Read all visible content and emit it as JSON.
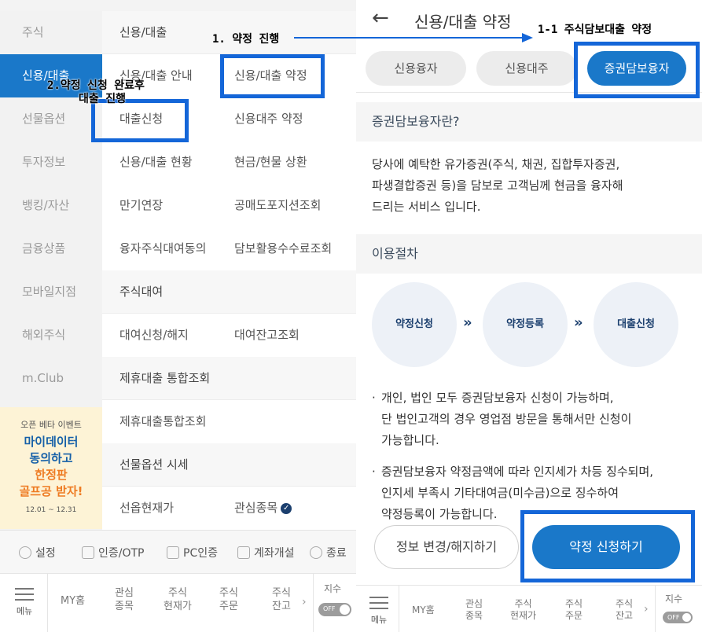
{
  "left": {
    "sidebar": [
      "주식",
      "신용/대출",
      "선물옵션",
      "투자정보",
      "뱅킹/자산",
      "금융상품",
      "모바일지점",
      "해외주식",
      "m.Club"
    ],
    "promo": {
      "top": "오픈 베타 이벤트",
      "line1": "마이데이터",
      "line2": "동의하고",
      "line3": "한정판",
      "line4": "골프공 받자!",
      "date": "12.01 ~ 12.31"
    },
    "menu": {
      "sec1": "신용/대출",
      "r1a": "신용/대출 안내",
      "r1b": "신용/대출 약정",
      "r2a": "대출신청",
      "r2b": "신용대주 약정",
      "r3a": "신용/대출 현황",
      "r3b": "현금/현물 상환",
      "r4a": "만기연장",
      "r4b": "공매도포지션조회",
      "r5a": "융자주식대여동의",
      "r5b": "담보활용수수료조회",
      "sec2": "주식대여",
      "r6a": "대여신청/해지",
      "r6b": "대여잔고조회",
      "sec3": "제휴대출 통합조회",
      "r7a": "제휴대출통합조회",
      "sec4": "선물옵션 시세",
      "r8a": "선옵현재가",
      "r8b": "관심종목"
    },
    "util": {
      "settings": "설정",
      "auth": "인증/OTP",
      "pc": "PC인증",
      "account": "계좌개설",
      "exit": "종료"
    }
  },
  "nav": {
    "menu": "메뉴",
    "home": "MY홈",
    "watch1": "관심",
    "watch2": "종목",
    "cur1": "주식",
    "cur2": "현재가",
    "order1": "주식",
    "order2": "주문",
    "bal1": "주식",
    "bal2": "잔고",
    "chev": "›",
    "index": "지수",
    "toggle": "OFF"
  },
  "right": {
    "back": "←",
    "title": "신용/대출 약정",
    "tabs": [
      "신용융자",
      "신용대주",
      "증권담보융자"
    ],
    "sec1": "증권담보융자란?",
    "desc": [
      "당사에 예탁한 유가증권(주식, 채권, 집합투자증권,",
      "파생결합증권 등)을 담보로 고객님께 현금을 융자해",
      "드리는 서비스 입니다."
    ],
    "sec2": "이용절차",
    "steps": [
      "약정신청",
      "약정등록",
      "대출신청"
    ],
    "chev": "»",
    "b1": [
      "개인, 법인 모두 증권담보융자 신청이 가능하며,",
      "단 법인고객의 경우 영업점 방문을 통해서만 신청이",
      "가능합니다."
    ],
    "b2": [
      "증권담보융자 약정금액에 따라 인지세가 차등 징수되며,",
      "인지세 부족시 기타대여금(미수금)으로 징수하여",
      "약정등록이 가능합니다."
    ],
    "bullet": "·",
    "btn_change": "정보 변경/해지하기",
    "btn_apply": "약정 신청하기"
  },
  "annotations": {
    "a1": "1. 약정 진행",
    "a11": "1-1 주식담보대출 약정",
    "a2a": "2.약정 신청 완료후",
    "a2b": "대출 진행"
  },
  "colors": {
    "accent": "#1a78c9",
    "highlight": "#1466d8"
  }
}
